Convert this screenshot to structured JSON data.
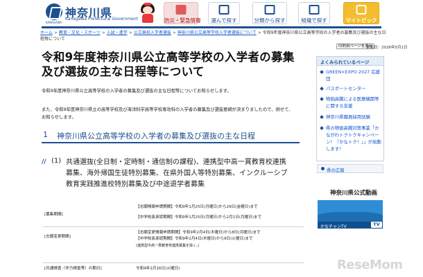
{
  "header": {
    "logo_name": "神奈川県",
    "logo_sub": "Kanagawa Prefectural Government",
    "logo_caption": "KANAGAWA",
    "nav": {
      "emergency": "防災・緊急情報",
      "choose": "選んで探す",
      "field": "分類から探す",
      "org": "組織で探す",
      "pick": "マイトピック"
    }
  },
  "breadcrumb": {
    "items": [
      "ホーム",
      "教育・文化・スポーツ",
      "入試・進学",
      "公立高校入学者選抜",
      "神奈川県公立高等学校入学者選抜について"
    ],
    "current": "令和9年度神奈川県公立高等学校の入学者の募集及び選抜の主な日程等について"
  },
  "page": {
    "title": "令和9年度神奈川県公立高等学校の入学者の募集及び選抜の主な日程等について",
    "print_label": "印刷用ページを表示",
    "updated": "更新日：2026年5月1日",
    "intro1": "令和9年度神奈川県公立高等学校の入学者の募集及び選抜の主な日程等についてお知らせします。",
    "intro2": "また、令和9年度神奈川県立の高等学校及び海洋科学高等学校専攻科の入学者の募集及び選抜要綱が決まりましたので、併せて、お知らせします。",
    "section_num": "1",
    "section_title": "神奈川県公立高等学校の入学者の募集及び選抜の主な日程",
    "sub_num": "(1)",
    "sub_title": "共通選抜(全日制・定時制・通信制の課程)、連携型中高一貫教育校連携募集、海外帰国生徒特別募集、在県外国人等特別募集、インクルーシブ教育実践推進校特別募集及び中途退学者募集"
  },
  "schedule": [
    {
      "label": "",
      "value": "【志願情報申請期間】令和9年1月25日(月曜日)から29日(金曜日)まで"
    },
    {
      "label": "[募集期間]",
      "value": "【中学校長承認期間】令和9年1月25日(月曜日)から2月1日(月曜日)まで"
    },
    {
      "label": "",
      "value": "【志願変更情報申請期間】令和9年2月4日(木曜日)から8日(月曜日)まで"
    },
    {
      "label": "[志願変更期間]",
      "value": "【中学校長承認期間】令和9年2月4日(木曜日)から9日(火曜日)まで"
    },
    {
      "label": "",
      "value": "(連携型中高一貫教育校連携募集を除く。)"
    },
    {
      "label": "[共通検査（学力検査等）の期日]",
      "value": "令和9年2月16日(火曜日)"
    }
  ],
  "sidebar": {
    "heading": "よくみられているページ",
    "items": [
      "GREEN×EXPO 2027 応援団",
      "パスポートセンター",
      "物価高騰による医療機関等に関する支援",
      "神奈川県職員採用試験",
      "県の物価高騰対策事業「かながわトクトクキャンペーン！『かなトク！』」が始動します！"
    ],
    "widget_label": "県の広報",
    "video_heading": "神奈川県公式動画",
    "video_caption": "かなチャンTV",
    "video_badge": "TV"
  },
  "watermark": "ReseMom"
}
